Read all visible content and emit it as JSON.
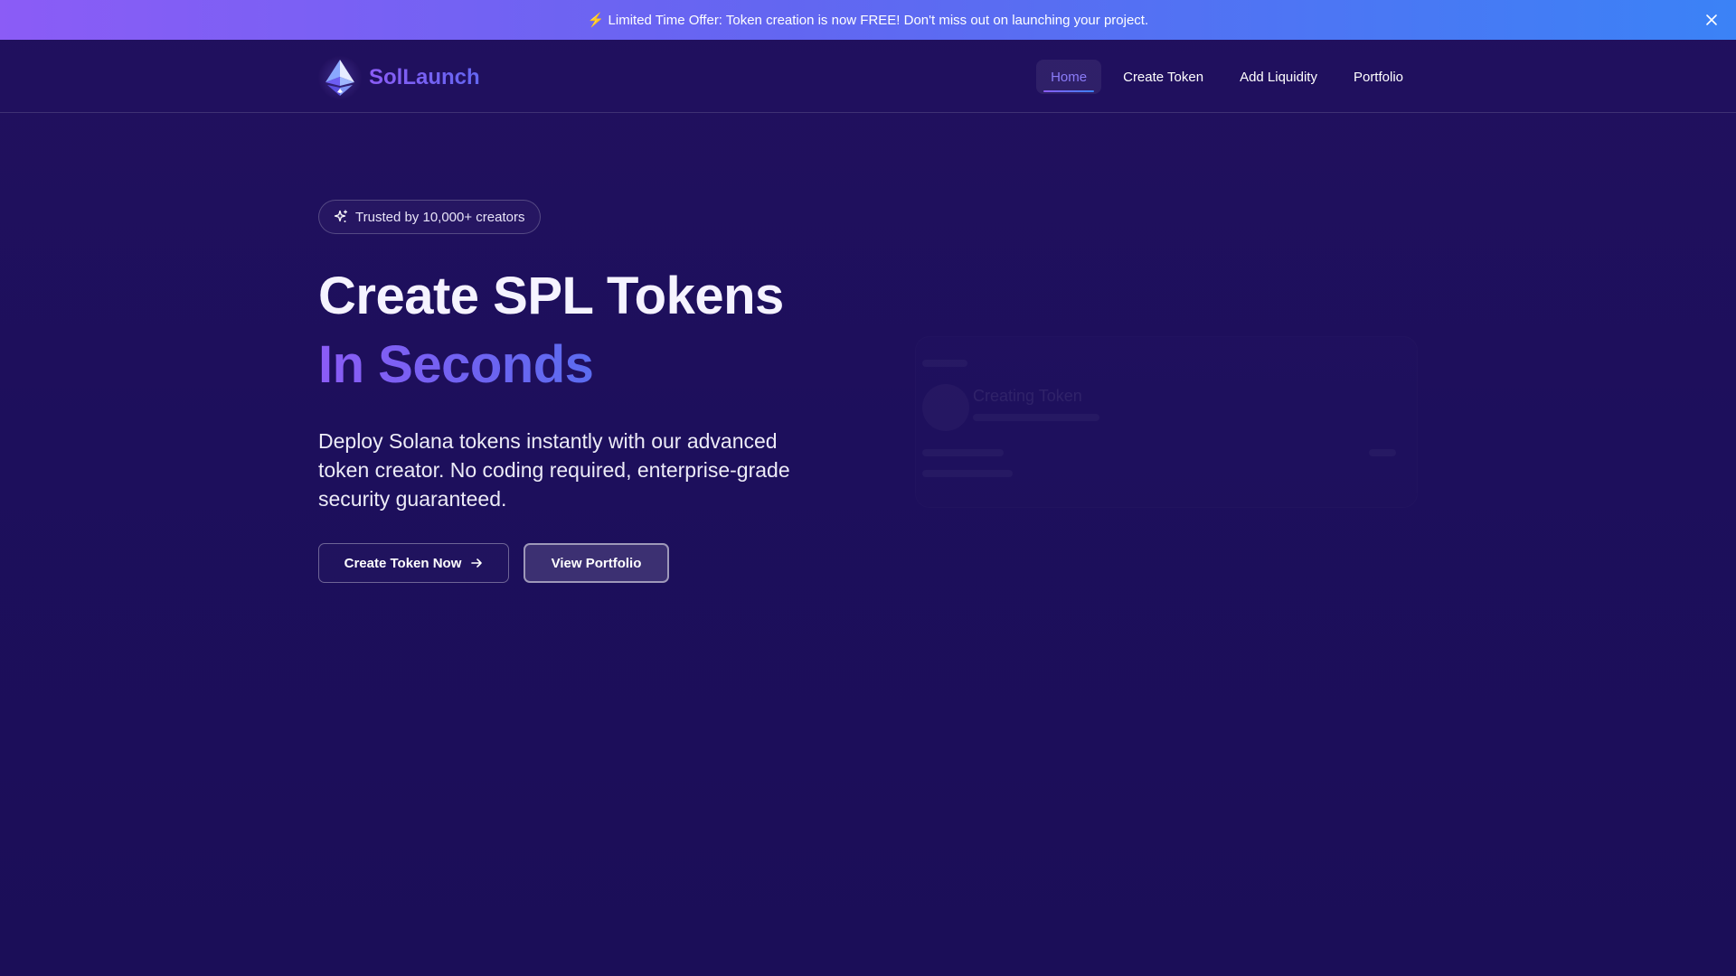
{
  "banner": {
    "bolt": "⚡",
    "text": "Limited Time Offer: Token creation is now FREE! Don't miss out on launching your project.",
    "close_icon": "close-icon"
  },
  "header": {
    "brand": "SolLaunch",
    "logo_icon": "solana-diamond-logo",
    "nav": [
      {
        "label": "Home",
        "active": true
      },
      {
        "label": "Create Token",
        "active": false
      },
      {
        "label": "Add Liquidity",
        "active": false
      },
      {
        "label": "Portfolio",
        "active": false
      }
    ]
  },
  "hero": {
    "badge": "Trusted by 10,000+ creators",
    "badge_icon": "sparkle-icon",
    "title": "Create SPL Tokens",
    "title_accent": "In Seconds",
    "description": "Deploy Solana tokens instantly with our advanced token creator. No coding required, enterprise-grade security guaranteed.",
    "primary_button": "Create Token Now",
    "primary_icon": "arrow-right-icon",
    "secondary_button": "View Portfolio"
  },
  "ghost_card": {
    "title": "Creating Token"
  },
  "colors": {
    "background": "#1d0f5c",
    "banner_start": "#8b5cf6",
    "banner_end": "#3b82f6",
    "accent": "#8b5cf6",
    "active_nav": "#8b7cf8"
  }
}
